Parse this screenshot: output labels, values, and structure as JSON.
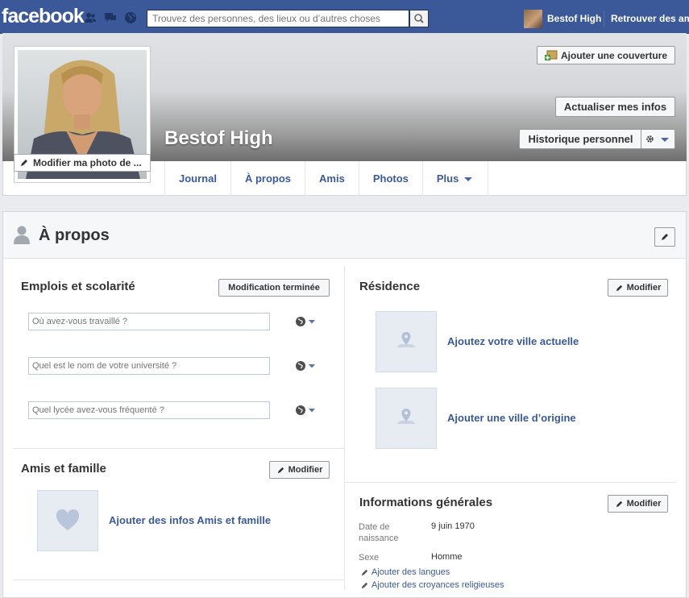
{
  "topbar": {
    "logo": "facebook",
    "search_placeholder": "Trouvez des personnes, des lieux ou d’autres choses",
    "user_name": "Bestof High",
    "find_friends": "Retrouver des amis"
  },
  "profile": {
    "name": "Bestof High",
    "edit_photo": "Modifier ma photo de ...",
    "add_cover": "Ajouter une couverture",
    "update_info": "Actualiser mes infos",
    "history": "Historique personnel"
  },
  "tabs": [
    {
      "label": "Journal"
    },
    {
      "label": "À propos"
    },
    {
      "label": "Amis"
    },
    {
      "label": "Photos"
    },
    {
      "label": "Plus"
    }
  ],
  "about": {
    "title": "À propos",
    "work": {
      "title": "Emplois et scolarité",
      "done_button": "Modification terminée",
      "fields": [
        {
          "placeholder": "Où avez-vous travaillé ?"
        },
        {
          "placeholder": "Quel est le nom de votre université ?"
        },
        {
          "placeholder": "Quel lycée avez-vous fréquenté ?"
        }
      ]
    },
    "residence": {
      "title": "Résidence",
      "edit_button": "Modifier",
      "current_city": "Ajoutez votre ville actuelle",
      "hometown": "Ajouter une ville d’origine"
    },
    "family": {
      "title": "Amis et famille",
      "edit_button": "Modifier",
      "add_link": "Ajouter des infos Amis et famille"
    },
    "general": {
      "title": "Informations générales",
      "edit_button": "Modifier",
      "birth_label": "Date de naissance",
      "birth_value": "9 juin 1970",
      "sex_label": "Sexe",
      "sex_value": "Homme",
      "add_languages": "Ajouter des langues",
      "add_religion": "Ajouter des croyances religieuses"
    }
  }
}
